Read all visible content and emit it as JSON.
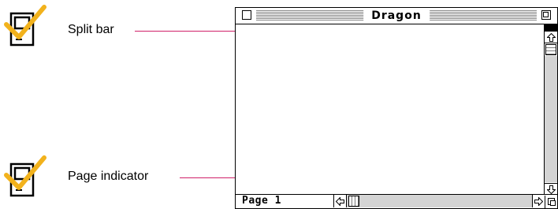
{
  "callouts": [
    {
      "label": "Split bar",
      "icon": "checked-macintosh-icon"
    },
    {
      "label": "Page indicator",
      "icon": "checked-macintosh-icon"
    }
  ],
  "window": {
    "title": "Dragon",
    "page_indicator": "Page 1",
    "icons": {
      "close": "close-box-icon",
      "zoom": "zoom-box-icon",
      "scroll_up": "up-arrow-icon",
      "scroll_down": "down-arrow-icon",
      "scroll_left": "left-arrow-icon",
      "scroll_right": "right-arrow-icon",
      "grow": "size-box-icon"
    }
  },
  "colors": {
    "leader_line": "#d0206a",
    "checkmark": "#f2b21c"
  }
}
